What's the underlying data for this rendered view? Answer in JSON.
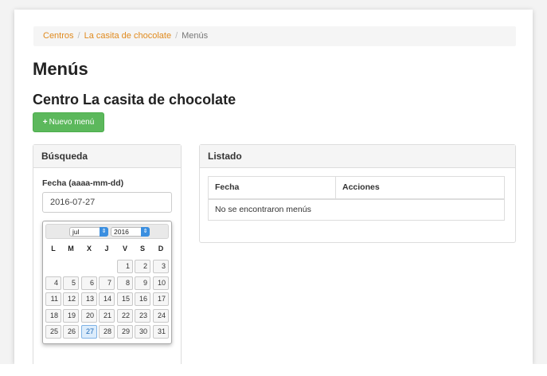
{
  "breadcrumb": {
    "items": [
      "Centros",
      "La casita de chocolate"
    ],
    "separator": "/",
    "active": "Menús"
  },
  "page_title": "Menús",
  "center_title": "Centro La casita de chocolate",
  "new_menu_button": {
    "icon": "+",
    "label": "Nuevo menú"
  },
  "search_panel": {
    "title": "Búsqueda",
    "date_label": "Fecha (aaaa-mm-dd)",
    "date_value": "2016-07-27",
    "calendar": {
      "month": "jul",
      "year": "2016",
      "weekdays": [
        "L",
        "M",
        "X",
        "J",
        "V",
        "S",
        "D"
      ],
      "weeks": [
        [
          "",
          "",
          "",
          "",
          "1",
          "2",
          "3"
        ],
        [
          "4",
          "5",
          "6",
          "7",
          "8",
          "9",
          "10"
        ],
        [
          "11",
          "12",
          "13",
          "14",
          "15",
          "16",
          "17"
        ],
        [
          "18",
          "19",
          "20",
          "21",
          "22",
          "23",
          "24"
        ],
        [
          "25",
          "26",
          "27",
          "28",
          "29",
          "30",
          "31"
        ]
      ],
      "selected_day": "27"
    }
  },
  "list_panel": {
    "title": "Listado",
    "columns": [
      "Fecha",
      "Acciones"
    ],
    "empty_message": "No se encontraron menús"
  },
  "colors": {
    "accent_green": "#5cb85c",
    "link_orange": "#e08a1e",
    "selected_day": "#dcecfb"
  }
}
